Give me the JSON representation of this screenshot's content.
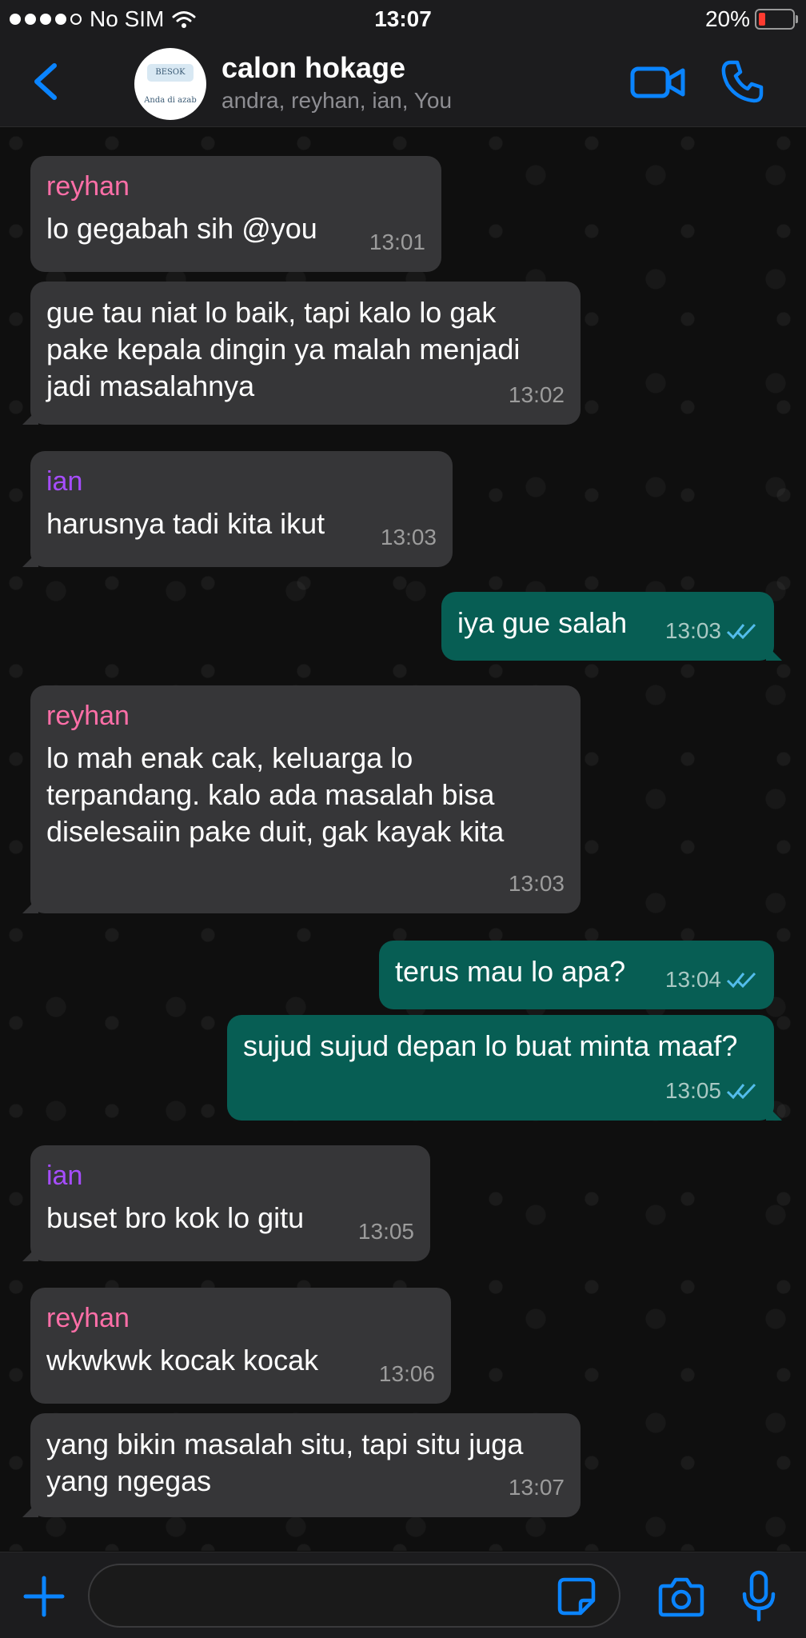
{
  "status_bar": {
    "carrier": "No SIM",
    "time": "13:07",
    "battery": "20%",
    "battery_level": 0.2
  },
  "header": {
    "title": "calon hokage",
    "members": "andra, reyhan, ian, You",
    "avatar_top_text": "BESOK",
    "avatar_caption": "Anda di azab"
  },
  "messages": [
    {
      "direction": "in",
      "sender": "reyhan",
      "text": "lo gegabah sih @you",
      "time": "13:01"
    },
    {
      "direction": "in",
      "text": "gue tau niat lo baik, tapi kalo lo gak pake kepala dingin ya malah menjadi jadi masalahnya",
      "time": "13:02"
    },
    {
      "direction": "in",
      "sender": "ian",
      "text": "harusnya tadi kita ikut",
      "time": "13:03"
    },
    {
      "direction": "out",
      "text": "iya gue salah",
      "time": "13:03"
    },
    {
      "direction": "in",
      "sender": "reyhan",
      "text": "lo mah enak cak, keluarga lo terpandang. kalo ada masalah bisa diselesaiin pake duit, gak kayak kita",
      "time": "13:03"
    },
    {
      "direction": "out",
      "text": "terus mau lo apa?",
      "time": "13:04"
    },
    {
      "direction": "out",
      "text": "sujud sujud depan lo buat minta maaf?",
      "time": "13:05"
    },
    {
      "direction": "in",
      "sender": "ian",
      "text": "buset bro kok lo gitu",
      "time": "13:05"
    },
    {
      "direction": "in",
      "sender": "reyhan",
      "text": "wkwkwk kocak kocak",
      "time": "13:06"
    },
    {
      "direction": "in",
      "text": "yang bikin masalah situ, tapi situ juga yang ngegas",
      "time": "13:07"
    }
  ],
  "composer": {
    "value": "",
    "placeholder": ""
  },
  "colors": {
    "accent": "#0a84ff",
    "incoming_bubble": "#363638",
    "outgoing_bubble": "#075e54",
    "sender_reyhan": "#ff6fa8",
    "sender_ian": "#a64dff",
    "read_ticks": "#53bdeb"
  },
  "icons": {
    "back": "chevron-left-icon",
    "video": "video-camera-icon",
    "call": "phone-icon",
    "plus": "plus-icon",
    "sticker": "sticker-icon",
    "camera": "camera-icon",
    "mic": "microphone-icon",
    "ticks": "double-check-icon"
  }
}
